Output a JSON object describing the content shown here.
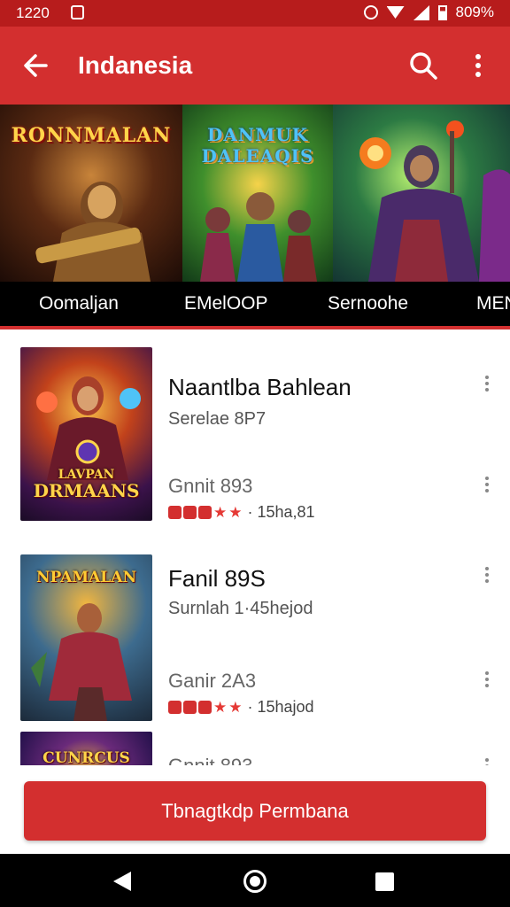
{
  "status_bar": {
    "time": "1220",
    "battery": "809%",
    "icons": [
      "notification-icon",
      "alarm-icon",
      "wifi-icon",
      "signal-icon",
      "battery-icon"
    ]
  },
  "app_bar": {
    "title": "Indanesia",
    "icons": [
      "back-arrow-icon",
      "search-icon",
      "more-vert-icon"
    ]
  },
  "banner": {
    "tiles": [
      {
        "logo": "RONNMALAN",
        "label": "Oomaljan"
      },
      {
        "logo": "DANMUK DALEAQIS",
        "label": "EMelOOP"
      },
      {
        "logo": "",
        "label": "Sernoohe"
      },
      {
        "logo": "",
        "label": "MEN"
      }
    ]
  },
  "list": {
    "items": [
      {
        "title": "Naantlba Bahlean",
        "subtitle": "Serelae 8P7",
        "game": "Gnnit 893",
        "rating_text": "· 15ha,81",
        "thumb_logo": "DRMAANS",
        "thumb_logo_small": "LAVPAN"
      },
      {
        "title": "Fanil 89S",
        "subtitle": "Surnlah 1·45hejod",
        "game": "Ganir 2A3",
        "rating_text": "· 15hajod",
        "thumb_logo": "NPAMALAN",
        "thumb_logo_small": ""
      },
      {
        "title": "",
        "subtitle": "",
        "game": "Gnnit 893",
        "rating_text": "",
        "thumb_logo": "CUNRCUS",
        "thumb_logo_small": ""
      }
    ]
  },
  "cta": {
    "label": "Tbnagtkdp Permbana"
  },
  "colors": {
    "primary": "#d32f2f",
    "status": "#b71c1c",
    "nav": "#000000"
  }
}
